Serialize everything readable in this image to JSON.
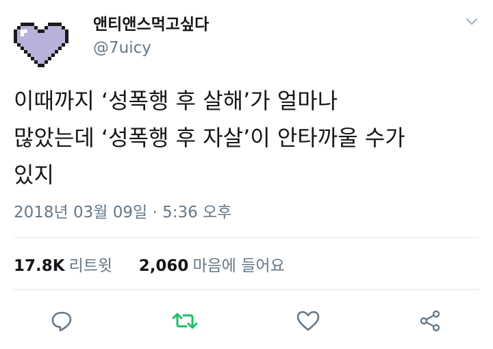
{
  "user": {
    "display_name": "앤티앤스먹고싶다",
    "handle": "@7uicy"
  },
  "tweet": {
    "text": "이때까지 ‘성폭행 후 살해’가 얼마나\n많았는데 ‘성폭행 후 자살’이 안타까울 수가\n있지",
    "timestamp": "2018년 03월 09일 · 5:36 오후"
  },
  "stats": {
    "retweets_count": "17.8K",
    "retweets_label": "리트윗",
    "likes_count": "2,060",
    "likes_label": "마음에 들어요"
  },
  "icons": {
    "avatar": "pixel-heart-avatar",
    "menu": "chevron-down-icon",
    "reply": "reply-icon",
    "retweet": "retweet-icon",
    "like": "heart-icon",
    "share": "share-icon"
  },
  "colors": {
    "text": "#14171a",
    "secondary": "#657786",
    "retweet_accent": "#17bf63",
    "icon": "#657786",
    "avatar_heart": "#b9b0dc"
  }
}
